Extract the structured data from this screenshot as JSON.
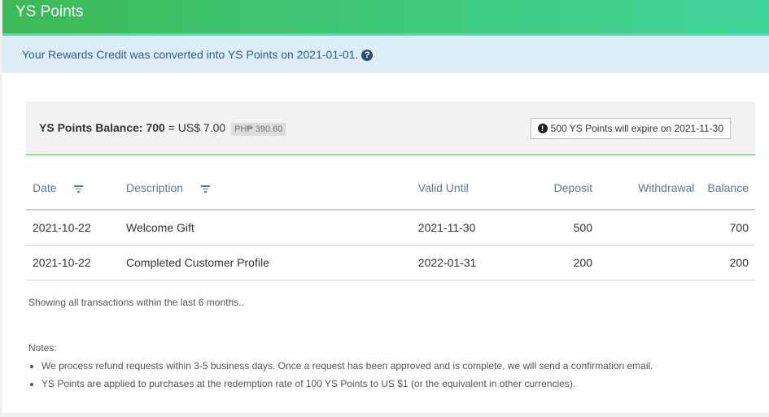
{
  "header": {
    "title": "YS Points"
  },
  "notice": {
    "text": "Your Rewards Credit was converted into YS Points on 2021-01-01."
  },
  "balance": {
    "label": "YS Points Balance: 700",
    "equals": " = US$ 7.00",
    "php": "PH₱ 390.60",
    "expire": "500 YS Points will expire on 2021-11-30"
  },
  "table": {
    "headers": {
      "date": "Date",
      "description": "Description",
      "valid_until": "Valid Until",
      "deposit": "Deposit",
      "withdrawal": "Withdrawal",
      "balance": "Balance"
    },
    "rows": [
      {
        "date": "2021-10-22",
        "description": "Welcome Gift",
        "valid_until": "2021-11-30",
        "deposit": "500",
        "withdrawal": "",
        "balance": "700"
      },
      {
        "date": "2021-10-22",
        "description": "Completed Customer Profile",
        "valid_until": "2022-01-31",
        "deposit": "200",
        "withdrawal": "",
        "balance": "200"
      }
    ]
  },
  "showing": "Showing all transactions within the last 6 months..",
  "notes": {
    "title": "Notes:",
    "items": [
      "We process refund requests within 3-5 business days. Once a request has been approved and is complete, we will send a confirmation email.",
      "YS Points are applied to purchases at the redemption rate of 100 YS Points to US $1 (or the equivalent in other currencies)."
    ]
  }
}
